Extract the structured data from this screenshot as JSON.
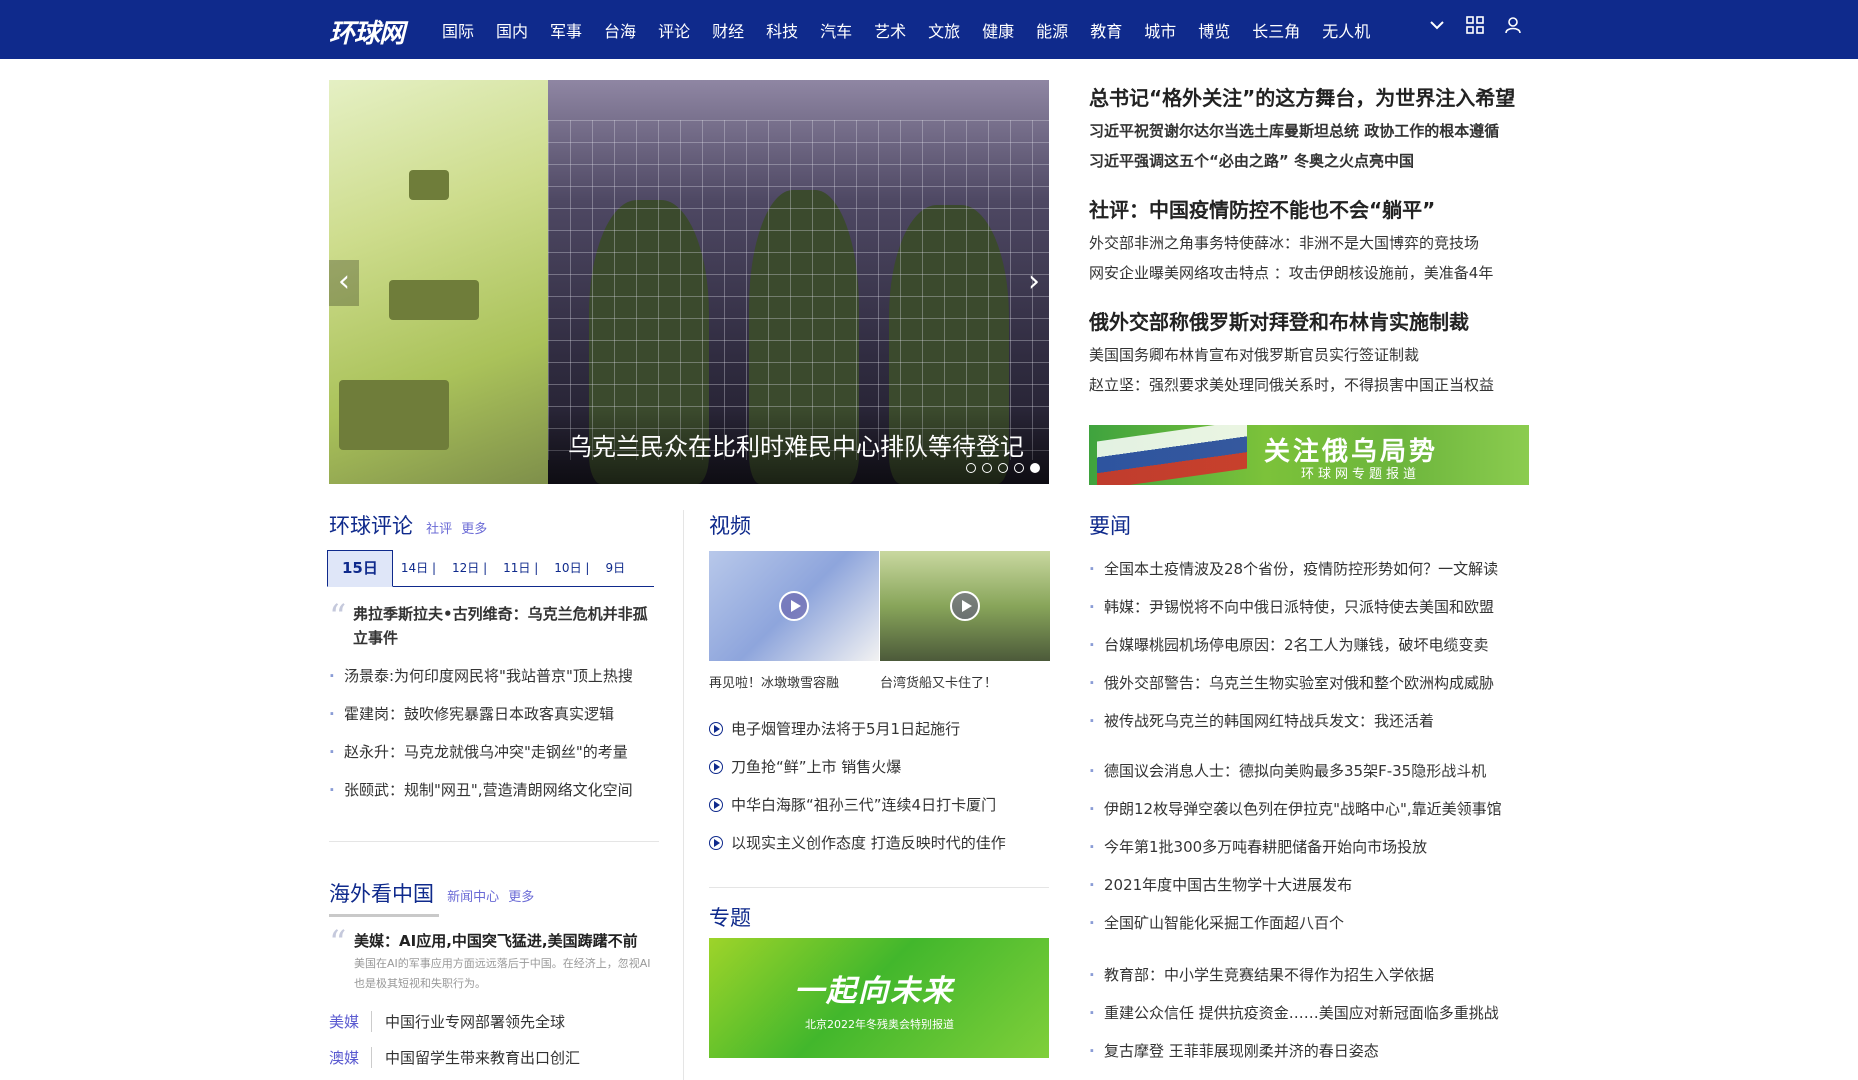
{
  "nav": {
    "logo": "环球网",
    "items": [
      "国际",
      "国内",
      "军事",
      "台海",
      "评论",
      "财经",
      "科技",
      "汽车",
      "艺术",
      "文旅",
      "健康",
      "能源",
      "教育",
      "城市",
      "博览",
      "长三角",
      "无人机"
    ]
  },
  "carousel": {
    "caption": "乌克兰民众在比利时难民中心排队等待登记",
    "dots": 5,
    "active_dot": 4
  },
  "headlines": {
    "groups": [
      {
        "main": "总书记“格外关注”的这方舞台，为世界注入希望",
        "subs": [
          "习近平祝贺谢尔达尔当选土库曼斯坦总统 政协工作的根本遵循",
          "习近平强调这五个“必由之路” 冬奥之火点亮中国"
        ],
        "subs_bold": true
      },
      {
        "main": "社评：中国疫情防控不能也不会“躺平”",
        "subs": [
          "外交部非洲之角事务特使薛冰：非洲不是大国博弈的竞技场",
          "网安企业曝美网络攻击特点 ：攻击伊朗核设施前，美准备4年"
        ],
        "subs_bold": false
      },
      {
        "main": "俄外交部称俄罗斯对拜登和布林肯实施制裁",
        "subs": [
          "美国国务卿布林肯宣布对俄罗斯官员实行签证制裁",
          "赵立坚：强烈要求美处理同俄关系时，不得损害中国正当权益"
        ],
        "subs_bold": false
      }
    ],
    "banner_title": "关注俄乌局势",
    "banner_sub": "环球网专题报道"
  },
  "comment": {
    "title": "环球评论",
    "links": [
      "社评",
      "更多"
    ],
    "tabs": [
      "15日",
      "14日",
      "12日",
      "11日",
      "10日",
      "9日"
    ],
    "active_tab": 0,
    "lead": "弗拉季斯拉夫•古列维奇：乌克兰危机并非孤立事件",
    "items": [
      "汤景泰:为何印度网民将\"我站普京\"顶上热搜",
      "霍建岗：鼓吹修宪暴露日本政客真实逻辑",
      "赵永升：马克龙就俄乌冲突\"走钢丝\"的考量",
      "张颐武：规制\"网丑\",营造清朗网络文化空间"
    ]
  },
  "overseas": {
    "title": "海外看中国",
    "links": [
      "新闻中心",
      "更多"
    ],
    "lead": "美媒：AI应用,中国突飞猛进,美国踌躇不前",
    "lead_desc": "美国在AI的军事应用方面远远落后于中国。在经济上，忽视AI也是极其短视和失职行为。",
    "items": [
      {
        "tag": "美媒",
        "text": "中国行业专网部署领先全球"
      },
      {
        "tag": "澳媒",
        "text": "中国留学生带来教育出口创汇"
      }
    ]
  },
  "video": {
    "title": "视频",
    "thumbs": [
      {
        "caption": "再见啦！冰墩墩雪容融"
      },
      {
        "caption": "台湾货船又卡住了！"
      }
    ],
    "items": [
      "电子烟管理办法将于5月1日起施行",
      "刀鱼抢“鲜”上市 销售火爆",
      "中华白海豚“祖孙三代”连续4日打卡厦门",
      "以现实主义创作态度 打造反映时代的佳作"
    ]
  },
  "topic": {
    "title": "专题",
    "banner_title": "一起向未来",
    "banner_sub": "北京2022年冬残奥会特别报道"
  },
  "news": {
    "title": "要闻",
    "group1": [
      "全国本土疫情波及28个省份，疫情防控形势如何？一文解读",
      "韩媒：尹锡悦将不向中俄日派特使，只派特使去美国和欧盟",
      "台媒曝桃园机场停电原因：2名工人为赚钱，破坏电缆变卖",
      "俄外交部警告：乌克兰生物实验室对俄和整个欧洲构成威胁",
      "被传战死乌克兰的韩国网红特战兵发文：我还活着"
    ],
    "group2": [
      "德国议会消息人士：德拟向美购最多35架F-35隐形战斗机",
      "伊朗12枚导弹空袭以色列在伊拉克\"战略中心\",靠近美领事馆",
      "今年第1批300多万吨春耕肥储备开始向市场投放",
      "2021年度中国古生物学十大进展发布",
      "全国矿山智能化采掘工作面超八百个"
    ],
    "group3": [
      "教育部：中小学生竞赛结果不得作为招生入学依据",
      "重建公众信任 提供抗疫资金……美国应对新冠面临多重挑战",
      "复古摩登 王菲菲展现刚柔并济的春日姿态"
    ]
  }
}
